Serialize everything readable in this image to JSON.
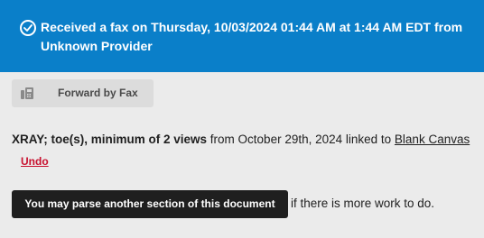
{
  "banner": {
    "icon": "check-circle-icon",
    "message": "Received a fax on Thursday, 10/03/2024 01:44 AM at 1:44 AM EDT from Unknown Provider",
    "color": "#0a7fc9"
  },
  "fax_button": {
    "icon": "fax-icon",
    "label": "Forward by Fax"
  },
  "record": {
    "title": "XRAY; toe(s), minimum of 2 views",
    "from_text": " from October 29th, 2024 linked to ",
    "link_text": "Blank Canvas"
  },
  "undo_label": "Undo",
  "parse_button_label": "You may parse another section of this document",
  "after_text": "if there is more work to do."
}
